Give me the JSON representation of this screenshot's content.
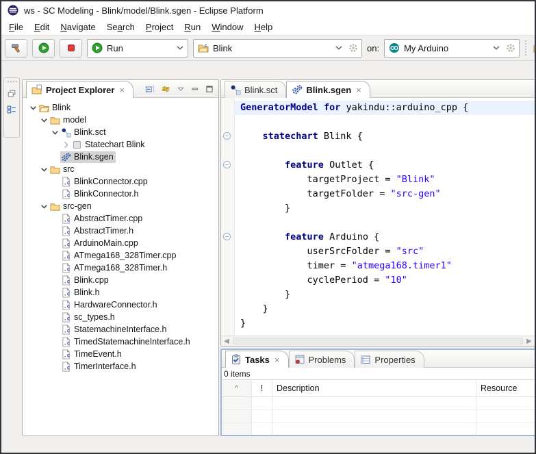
{
  "window": {
    "title": "ws - SC Modeling - Blink/model/Blink.sgen - Eclipse Platform",
    "icon": "eclipse-logo-icon"
  },
  "menubar": {
    "items": [
      {
        "label": "File",
        "mnemonic": 0
      },
      {
        "label": "Edit",
        "mnemonic": 0
      },
      {
        "label": "Navigate",
        "mnemonic": 0
      },
      {
        "label": "Search",
        "mnemonic": 2
      },
      {
        "label": "Project",
        "mnemonic": 0
      },
      {
        "label": "Run",
        "mnemonic": 0
      },
      {
        "label": "Window",
        "mnemonic": 0
      },
      {
        "label": "Help",
        "mnemonic": 0
      }
    ]
  },
  "toolbar": {
    "buttons": [
      {
        "name": "build",
        "icon": "hammer-icon"
      },
      {
        "name": "resume",
        "icon": "play-icon"
      },
      {
        "name": "terminate",
        "icon": "stop-icon"
      }
    ],
    "run_combo": {
      "label": "Run",
      "icon": "play-icon"
    },
    "project_combo": {
      "label": "Blink",
      "icon": "open-folder-c-icon"
    },
    "on_label": "on:",
    "device_combo": {
      "label": "My Arduino",
      "icon": "arduino-icon"
    },
    "end_button": {
      "name": "new-wizard",
      "icon": "new-wizard-icon"
    }
  },
  "rail": {
    "items": [
      {
        "name": "restore-views",
        "icon": "restore-icon"
      },
      {
        "name": "statechart-view",
        "icon": "perspective-icon"
      }
    ]
  },
  "explorer": {
    "title": "Project Explorer",
    "view_actions": [
      {
        "name": "collapse-all",
        "icon": "collapse-all-icon"
      },
      {
        "name": "link-with-editor",
        "icon": "link-editor-icon"
      },
      {
        "name": "view-menu",
        "icon": "view-menu-icon"
      },
      {
        "name": "minimize",
        "icon": "minimize-icon"
      },
      {
        "name": "maximize",
        "icon": "maximize-icon"
      }
    ],
    "tree": [
      {
        "label": "Blink",
        "icon": "project-folder-icon",
        "depth": 0,
        "expander": "open"
      },
      {
        "label": "model",
        "icon": "folder-icon",
        "depth": 1,
        "expander": "open"
      },
      {
        "label": "Blink.sct",
        "icon": "statechart-icon",
        "depth": 2,
        "expander": "open"
      },
      {
        "label": "Statechart Blink",
        "icon": "statechart-node-icon",
        "depth": 3,
        "expander": "closed"
      },
      {
        "label": "Blink.sgen",
        "icon": "gears-icon",
        "depth": 2,
        "expander": null,
        "selected": true
      },
      {
        "label": "src",
        "icon": "folder-icon",
        "depth": 1,
        "expander": "open"
      },
      {
        "label": "BlinkConnector.cpp",
        "icon": "c-file-icon",
        "depth": 2,
        "expander": null
      },
      {
        "label": "BlinkConnector.h",
        "icon": "c-file-icon",
        "depth": 2,
        "expander": null
      },
      {
        "label": "src-gen",
        "icon": "folder-icon",
        "depth": 1,
        "expander": "open"
      },
      {
        "label": "AbstractTimer.cpp",
        "icon": "c-file-icon",
        "depth": 2,
        "expander": null
      },
      {
        "label": "AbstractTimer.h",
        "icon": "c-file-icon",
        "depth": 2,
        "expander": null
      },
      {
        "label": "ArduinoMain.cpp",
        "icon": "c-file-icon",
        "depth": 2,
        "expander": null
      },
      {
        "label": "ATmega168_328Timer.cpp",
        "icon": "c-file-icon",
        "depth": 2,
        "expander": null
      },
      {
        "label": "ATmega168_328Timer.h",
        "icon": "c-file-icon",
        "depth": 2,
        "expander": null
      },
      {
        "label": "Blink.cpp",
        "icon": "c-file-icon",
        "depth": 2,
        "expander": null
      },
      {
        "label": "Blink.h",
        "icon": "c-file-icon",
        "depth": 2,
        "expander": null
      },
      {
        "label": "HardwareConnector.h",
        "icon": "c-file-icon",
        "depth": 2,
        "expander": null
      },
      {
        "label": "sc_types.h",
        "icon": "c-file-icon",
        "depth": 2,
        "expander": null
      },
      {
        "label": "StatemachineInterface.h",
        "icon": "c-file-icon",
        "depth": 2,
        "expander": null
      },
      {
        "label": "TimedStatemachineInterface.h",
        "icon": "c-file-icon",
        "depth": 2,
        "expander": null
      },
      {
        "label": "TimeEvent.h",
        "icon": "c-file-icon",
        "depth": 2,
        "expander": null
      },
      {
        "label": "TimerInterface.h",
        "icon": "c-file-icon",
        "depth": 2,
        "expander": null
      }
    ]
  },
  "editor": {
    "tabs": [
      {
        "label": "Blink.sct",
        "icon": "statechart-icon",
        "active": false,
        "closable": false
      },
      {
        "label": "Blink.sgen",
        "icon": "gears-icon",
        "active": true,
        "closable": true
      }
    ],
    "code": {
      "lines": [
        {
          "hl": true,
          "fold": false,
          "seg": [
            [
              "k",
              "GeneratorModel"
            ],
            [
              "p",
              " "
            ],
            [
              "k",
              "for"
            ],
            [
              "p",
              " yakindu::arduino_cpp {"
            ]
          ]
        },
        {
          "hl": false,
          "fold": false,
          "seg": []
        },
        {
          "hl": false,
          "fold": true,
          "seg": [
            [
              "p",
              "    "
            ],
            [
              "k",
              "statechart"
            ],
            [
              "p",
              " Blink {"
            ]
          ]
        },
        {
          "hl": false,
          "fold": false,
          "seg": []
        },
        {
          "hl": false,
          "fold": true,
          "seg": [
            [
              "p",
              "        "
            ],
            [
              "k",
              "feature"
            ],
            [
              "p",
              " Outlet {"
            ]
          ]
        },
        {
          "hl": false,
          "fold": false,
          "seg": [
            [
              "p",
              "            targetProject = "
            ],
            [
              "s",
              "\"Blink\""
            ]
          ]
        },
        {
          "hl": false,
          "fold": false,
          "seg": [
            [
              "p",
              "            targetFolder = "
            ],
            [
              "s",
              "\"src-gen\""
            ]
          ]
        },
        {
          "hl": false,
          "fold": false,
          "seg": [
            [
              "p",
              "        }"
            ]
          ]
        },
        {
          "hl": false,
          "fold": false,
          "seg": []
        },
        {
          "hl": false,
          "fold": true,
          "seg": [
            [
              "p",
              "        "
            ],
            [
              "k",
              "feature"
            ],
            [
              "p",
              " Arduino {"
            ]
          ]
        },
        {
          "hl": false,
          "fold": false,
          "seg": [
            [
              "p",
              "            userSrcFolder = "
            ],
            [
              "s",
              "\"src\""
            ]
          ]
        },
        {
          "hl": false,
          "fold": false,
          "seg": [
            [
              "p",
              "            timer = "
            ],
            [
              "s",
              "\"atmega168.timer1\""
            ]
          ]
        },
        {
          "hl": false,
          "fold": false,
          "seg": [
            [
              "p",
              "            cyclePeriod = "
            ],
            [
              "s",
              "\"10\""
            ]
          ]
        },
        {
          "hl": false,
          "fold": false,
          "seg": [
            [
              "p",
              "        }"
            ]
          ]
        },
        {
          "hl": false,
          "fold": false,
          "seg": [
            [
              "p",
              "    }"
            ]
          ]
        },
        {
          "hl": false,
          "fold": false,
          "seg": [
            [
              "p",
              "}"
            ]
          ]
        }
      ]
    }
  },
  "tasks": {
    "tabs": [
      {
        "label": "Tasks",
        "icon": "tasks-icon",
        "active": true,
        "closable": true
      },
      {
        "label": "Problems",
        "icon": "problems-icon",
        "active": false,
        "closable": false
      },
      {
        "label": "Properties",
        "icon": "properties-icon",
        "active": false,
        "closable": false
      }
    ],
    "status": "0 items",
    "table": {
      "columns": [
        {
          "label": "",
          "sort": "asc"
        },
        {
          "label": "!"
        },
        {
          "label": "Description"
        },
        {
          "label": "Resource"
        }
      ],
      "rows": []
    }
  },
  "colors": {
    "keyword": "#000083",
    "string": "#2a00ff",
    "current_line_bg": "#e9f2fd",
    "selection_bg": "#d4d4d4",
    "active_part_border": "#9fb8d7",
    "folder_yellow": "#ffd78e",
    "arduino_teal": "#00878f"
  }
}
